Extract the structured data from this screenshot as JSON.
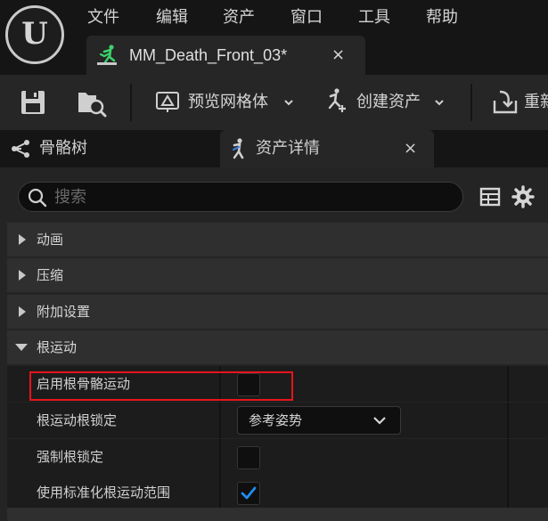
{
  "app": {
    "logo": "unreal-logo"
  },
  "menu": [
    "文件",
    "编辑",
    "资产",
    "窗口",
    "工具",
    "帮助"
  ],
  "document_tab": {
    "title": "MM_Death_Front_03*",
    "close": "×",
    "icon": "animation-sequence-icon"
  },
  "toolbar": {
    "save_icon": "save-icon",
    "browse_icon": "browse-asset-icon",
    "preview_mesh_label": "预览网格体",
    "create_asset_label": "创建资产",
    "reimport_label": "重新"
  },
  "panel_tabs": {
    "skeleton_tree": "骨骼树",
    "asset_details": "资产详情",
    "close": "×"
  },
  "search": {
    "placeholder": "搜索"
  },
  "categories": [
    {
      "label": "动画",
      "expanded": false
    },
    {
      "label": "压缩",
      "expanded": false
    },
    {
      "label": "附加设置",
      "expanded": false
    },
    {
      "label": "根运动",
      "expanded": true
    }
  ],
  "properties": [
    {
      "label": "启用根骨骼运动",
      "type": "checkbox",
      "checked": false
    },
    {
      "label": "根运动根锁定",
      "type": "dropdown",
      "value": "参考姿势"
    },
    {
      "label": "强制根锁定",
      "type": "checkbox",
      "checked": false
    },
    {
      "label": "使用标准化根运动范围",
      "type": "checkbox",
      "checked": true
    }
  ],
  "colors": {
    "accent": "#1e8ef0",
    "highlight": "#e8141b",
    "panel": "#242424"
  }
}
